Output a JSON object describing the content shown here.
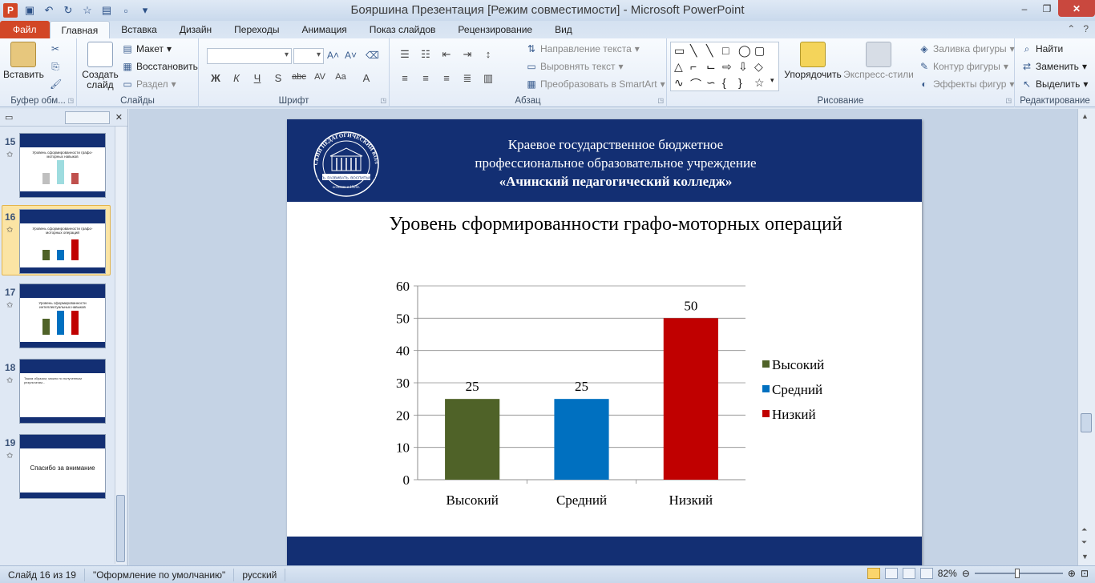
{
  "window": {
    "title": "Бояршина Презентация [Режим совместимости]  -  Microsoft PowerPoint",
    "app_icon_letter": "P"
  },
  "tabs": [
    {
      "label": "Файл",
      "type": "file"
    },
    {
      "label": "Главная",
      "type": "active"
    },
    {
      "label": "Вставка"
    },
    {
      "label": "Дизайн"
    },
    {
      "label": "Переходы"
    },
    {
      "label": "Анимация"
    },
    {
      "label": "Показ слайдов"
    },
    {
      "label": "Рецензирование"
    },
    {
      "label": "Вид"
    }
  ],
  "ribbon": {
    "clipboard": {
      "label": "Буфер обм...",
      "paste": "Вставить"
    },
    "slides": {
      "label": "Слайды",
      "new_slide_1": "Создать",
      "new_slide_2": "слайд",
      "layout": "Макет",
      "reset": "Восстановить",
      "section": "Раздел"
    },
    "font": {
      "label": "Шрифт"
    },
    "paragraph": {
      "label": "Абзац",
      "text_direction": "Направление текста",
      "align_text": "Выровнять текст",
      "smartart": "Преобразовать в SmartArt"
    },
    "drawing": {
      "label": "Рисование",
      "arrange": "Упорядочить",
      "quick_styles": "Экспресс-стили",
      "shape_fill": "Заливка фигуры",
      "shape_outline": "Контур фигуры",
      "shape_effects": "Эффекты фигур"
    },
    "editing": {
      "label": "Редактирование",
      "find": "Найти",
      "replace": "Заменить",
      "select": "Выделить"
    }
  },
  "thumbnails": [
    {
      "num": "15",
      "title": "Уровень сформированности графо-моторных навыков"
    },
    {
      "num": "16",
      "title": "Уровень сформированности графо-моторных операций"
    },
    {
      "num": "17",
      "title": "Уровень сформированности интеллектуальных навыков"
    },
    {
      "num": "18",
      "title": "",
      "text": "Таким образом, можно по полученным результатам..."
    },
    {
      "num": "19",
      "title": "",
      "center": "Спасибо за внимание"
    }
  ],
  "slide": {
    "header_line1": "Краевое государственное бюджетное",
    "header_line2": "профессиональное образовательное учреждение",
    "header_line3": "«Ачинский педагогический колледж»",
    "logo_text": "АЧИНСКИЙ ПЕДАГОГИЧЕСКИЙ КОЛЛЕДЖ",
    "logo_motto": "УЧИТЬ. РАЗВИВАТЬ. ВОСПИТЫВАТЬ.",
    "logo_year": "основан в 1920г."
  },
  "chart_data": {
    "type": "bar",
    "title": "Уровень сформированности графо-моторных операций",
    "categories": [
      "Высокий",
      "Средний",
      "Низкий"
    ],
    "values": [
      25,
      25,
      50
    ],
    "data_labels": [
      "25",
      "25",
      "50"
    ],
    "colors": [
      "#4f6228",
      "#0070c0",
      "#c00000"
    ],
    "legend": [
      {
        "name": "Высокий",
        "color": "#4f6228"
      },
      {
        "name": "Средний",
        "color": "#0070c0"
      },
      {
        "name": "Низкий",
        "color": "#c00000"
      }
    ],
    "legend_position": "right",
    "yticks": [
      "0",
      "10",
      "20",
      "30",
      "40",
      "50",
      "60"
    ],
    "ylim": [
      0,
      60
    ],
    "grid": true,
    "xlabel": "",
    "ylabel": ""
  },
  "status": {
    "slide_info": "Слайд 16 из 19",
    "theme": "\"Оформление по умолчанию\"",
    "language": "русский",
    "zoom": "82%"
  }
}
